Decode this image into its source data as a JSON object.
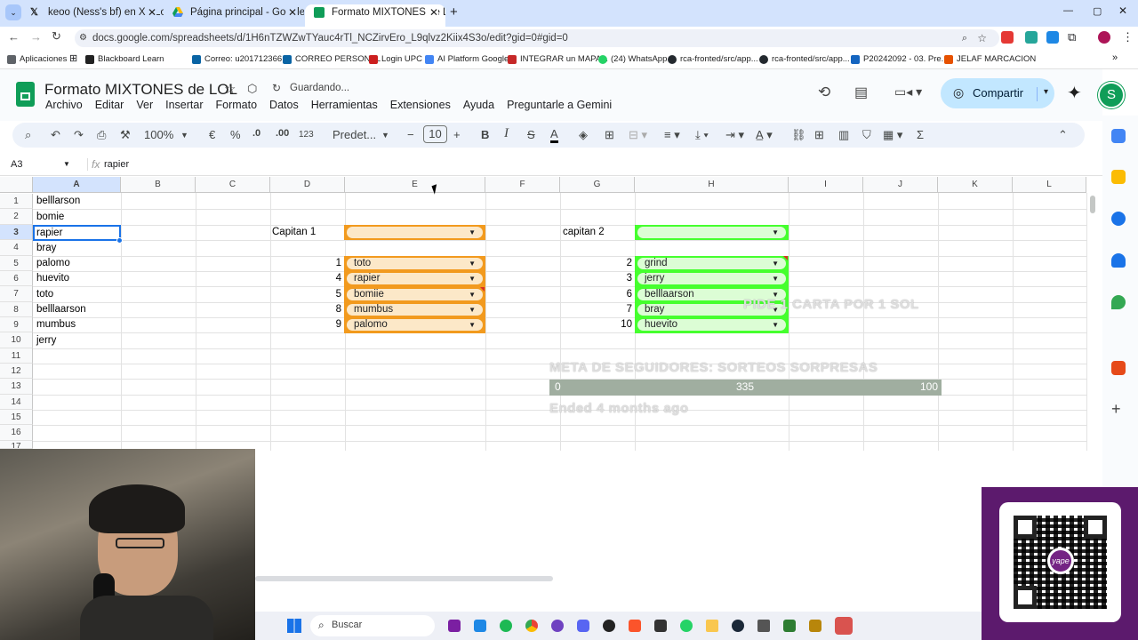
{
  "browser": {
    "tabs": [
      {
        "label": "keoo (Ness's bf) en X: \"Lo q pe",
        "color": "#000000"
      },
      {
        "label": "Página principal - Google Drive",
        "color": "#1a73e8"
      },
      {
        "label": "Formato MIXTONES de LOL - H",
        "color": "#0f9d58"
      }
    ],
    "new_tab": "+",
    "url": "docs.google.com/spreadsheets/d/1H6nTZWZwTYauc4rTl_NCZirvEro_L9qlvz2Kiix4S3o/edit?gid=0#gid=0",
    "bookmarks": [
      {
        "label": "Aplicaciones",
        "color": "#5f6368"
      },
      {
        "label": "Blackboard Learn",
        "color": "#222222"
      },
      {
        "label": "Correo: u201712366...",
        "color": "#0a64a4"
      },
      {
        "label": "CORREO PERSONAL",
        "color": "#0a64a4"
      },
      {
        "label": "Login UPC",
        "color": "#cc1f1f"
      },
      {
        "label": "AI Platform Google",
        "color": "#4285f4"
      },
      {
        "label": "INTEGRAR un MAPA...",
        "color": "#c62828"
      },
      {
        "label": "(24) WhatsApp",
        "color": "#25d366"
      },
      {
        "label": "rca-fronted/src/app...",
        "color": "#24292f"
      },
      {
        "label": "rca-fronted/src/app...",
        "color": "#24292f"
      },
      {
        "label": "P20242092 - 03. Pre...",
        "color": "#1565c0"
      },
      {
        "label": "JELAF MARCACION",
        "color": "#e65100"
      }
    ]
  },
  "doc": {
    "title": "Formato MIXTONES de LOL",
    "status": "Guardando...",
    "menu": [
      "Archivo",
      "Editar",
      "Ver",
      "Insertar",
      "Formato",
      "Datos",
      "Herramientas",
      "Extensiones",
      "Ayuda",
      "Preguntarle a Gemini"
    ],
    "share_label": "Compartir",
    "avatar_letter": "S",
    "accent": "#0f9d58"
  },
  "toolbar": {
    "zoom": "100%",
    "currency": "€",
    "percent": "%",
    "dec_less": ".0",
    "dec_more": ".00",
    "number_format": "123",
    "font": "Predet...",
    "font_size": "10",
    "minus": "−",
    "plus": "+",
    "bold": "B",
    "italic": "I",
    "strike": "S",
    "textcolor": "A",
    "sigma": "Σ"
  },
  "formula": {
    "cell_ref": "A3",
    "fx": "fx",
    "content": "rapier"
  },
  "columns": [
    "A",
    "B",
    "C",
    "D",
    "E",
    "F",
    "G",
    "H",
    "I",
    "J",
    "K",
    "L"
  ],
  "rows": [
    "1",
    "2",
    "3",
    "4",
    "5",
    "6",
    "7",
    "8",
    "9",
    "10",
    "11",
    "12",
    "13",
    "14",
    "15",
    "16",
    "17"
  ],
  "colA": [
    "belllarson",
    "bomie",
    "rapier",
    "bray",
    "palomo",
    "huevito",
    "toto",
    "belllaarson",
    "mumbus",
    "jerry"
  ],
  "captain1": {
    "label": "Capitan 1",
    "selected": "",
    "numbers": [
      "1",
      "4",
      "5",
      "8",
      "9"
    ],
    "players": [
      "toto",
      "rapier",
      "bomiie",
      "mumbus",
      "palomo"
    ],
    "color": "#f29a1e"
  },
  "captain2": {
    "label": "capitan 2",
    "selected": "",
    "numbers": [
      "2",
      "3",
      "6",
      "7",
      "10"
    ],
    "players": [
      "grind",
      "jerry",
      "belllaarson",
      "bray",
      "huevito"
    ],
    "color": "#45ff2e"
  },
  "stream": {
    "overlay_text": "PIDE 1 CARTA POR 1 SOL",
    "goal_title": "META DE SEGUIDORES: SORTEOS SORPRESAS",
    "goal_start": "0",
    "goal_current": "335",
    "goal_end": "100",
    "goal_status": "Ended 4 months ago",
    "qr_brand": "yape",
    "qr_bg": "#5c1a6d"
  },
  "taskbar": {
    "search_label": "Buscar"
  }
}
